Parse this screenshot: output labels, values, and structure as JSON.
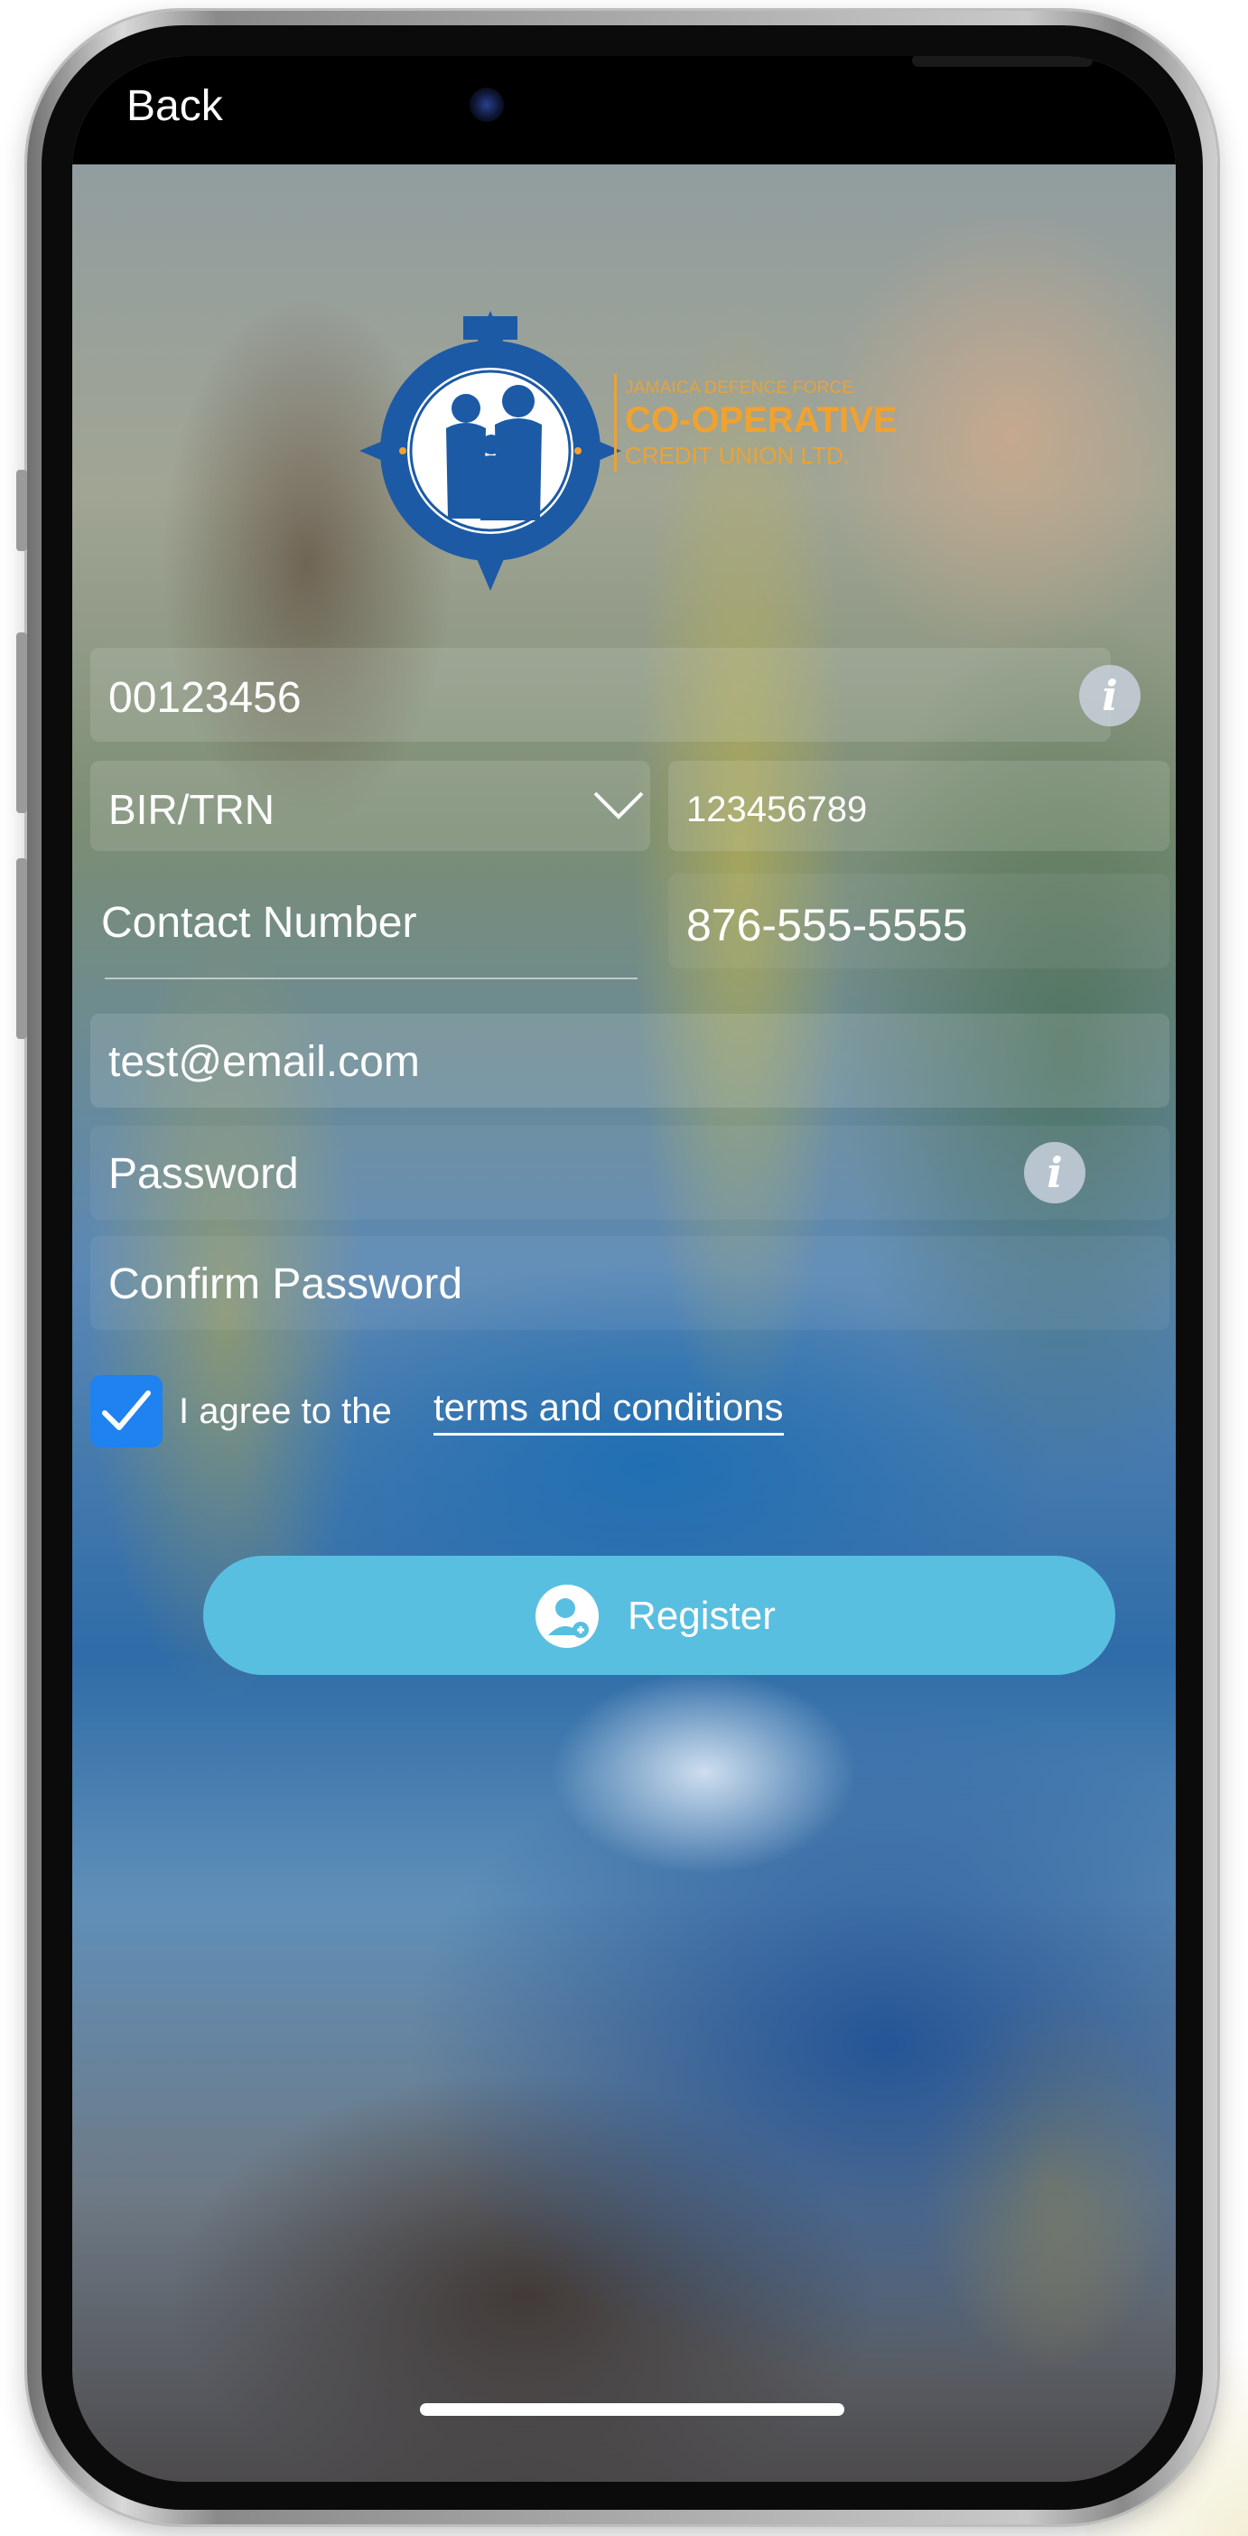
{
  "nav": {
    "back_label": "Back"
  },
  "logo": {
    "line1": "JAMAICA DEFENCE FORCE",
    "line2": "CO-OPERATIVE",
    "line3": "CREDIT UNION LTD.",
    "seal_ring_text_top": "JAMAICA DEFENCE FORCE",
    "seal_ring_text_bottom": "CO-OPERATIVE CREDIT UNION LIMITED"
  },
  "form": {
    "account_number": "00123456",
    "id_type": "BIR/TRN",
    "id_number": "123456789",
    "contact_label": "Contact Number",
    "contact_value": "876-555-5555",
    "email": "test@email.com",
    "password_placeholder": "Password",
    "confirm_password_placeholder": "Confirm Password",
    "agree_prefix": "I agree to the",
    "terms_link": "terms and conditions",
    "terms_checked": true,
    "register_label": "Register"
  },
  "icons": {
    "info": "info-icon",
    "dropdown": "chevron-down-icon",
    "check": "checkmark-icon",
    "register": "add-user-icon"
  },
  "colors": {
    "accent_button": "#59bfe0",
    "checkbox": "#1e82f0",
    "logo_blue": "#1c5aa6",
    "logo_orange": "#f0a230"
  }
}
